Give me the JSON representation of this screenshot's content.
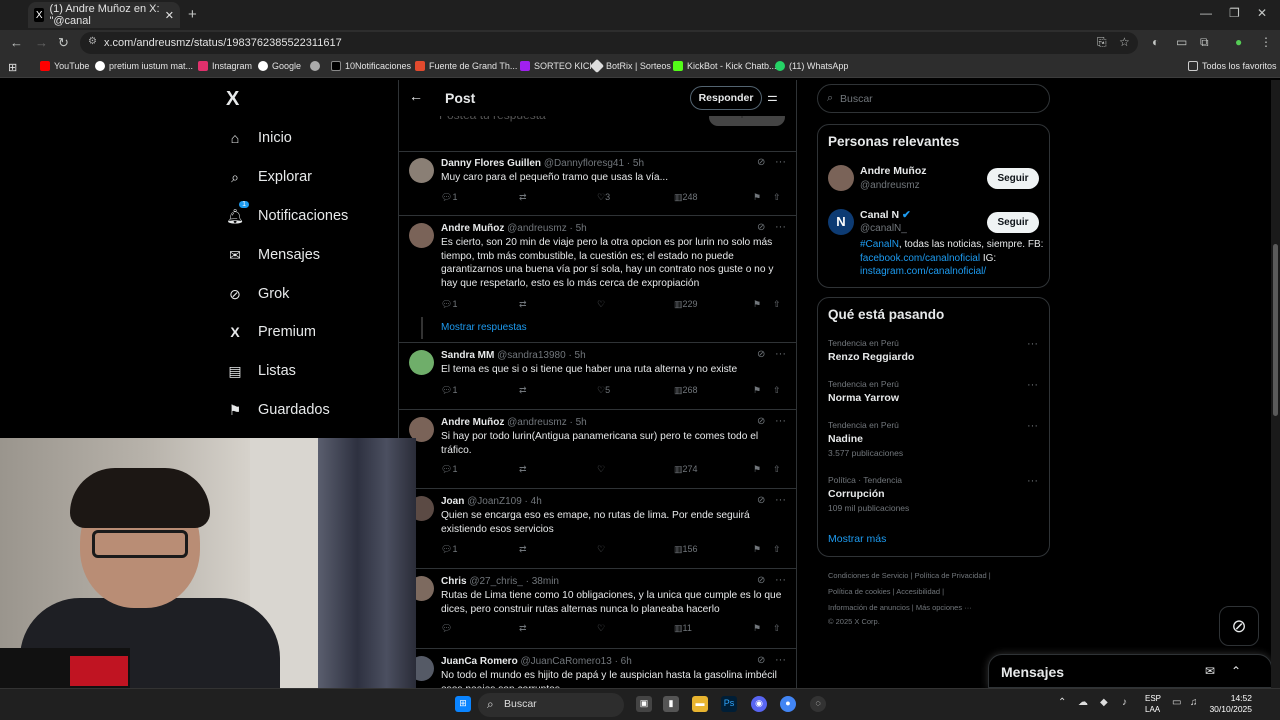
{
  "browser": {
    "tab_title": "(1) Andre Muñoz en X: \"@canal",
    "url": "x.com/andreusmz/status/1983762385522311617",
    "bookmarks": [
      {
        "label": "YouTube",
        "color": "#ff0000"
      },
      {
        "label": "pretium iustum mat...",
        "color": "#ffffff"
      },
      {
        "label": "Instagram",
        "color": "#e1306c"
      },
      {
        "label": "Google",
        "color": "#ffffff"
      },
      {
        "label": "",
        "color": "#aaaaaa"
      },
      {
        "label": "10Notificaciones",
        "color": "#000000"
      },
      {
        "label": "Fuente de Grand Th...",
        "color": "#e24a2e"
      },
      {
        "label": "SORTEO KICK",
        "color": "#a020f0"
      },
      {
        "label": "BotRix | Sorteos",
        "color": "#dddddd"
      },
      {
        "label": "KickBot - Kick Chatb...",
        "color": "#53fc18"
      },
      {
        "label": "(11) WhatsApp",
        "color": "#25d366"
      }
    ],
    "all_bookmarks": "Todos los favoritos"
  },
  "sidebar": {
    "logo": "X",
    "items": [
      {
        "label": "Inicio",
        "icon": "home-icon",
        "glyph": "⌂"
      },
      {
        "label": "Explorar",
        "icon": "search-icon",
        "glyph": "⌕"
      },
      {
        "label": "Notificaciones",
        "icon": "bell-icon",
        "glyph": "♫",
        "badge": "1"
      },
      {
        "label": "Mensajes",
        "icon": "mail-icon",
        "glyph": "✉"
      },
      {
        "label": "Grok",
        "icon": "grok-icon",
        "glyph": "⊘"
      },
      {
        "label": "Premium",
        "icon": "x-icon",
        "glyph": "X"
      },
      {
        "label": "Listas",
        "icon": "list-icon",
        "glyph": "▤"
      },
      {
        "label": "Guardados",
        "icon": "bookmark-icon",
        "glyph": "⚑"
      }
    ]
  },
  "post": {
    "title": "Post",
    "reply_button": "Responder",
    "ghost_text": "Postea tu respuesta",
    "ghost_button": "Responder",
    "show_replies": "Mostrar respuestas",
    "tweets": [
      {
        "name": "Danny Flores Guillen",
        "handle": "@Dannyfloresg41",
        "time": "· 5h",
        "text": "Muy caro para el pequeño tramo que usas la vía...",
        "replies": "1",
        "likes": "3",
        "views": "248",
        "avatar": "#8a7f75"
      },
      {
        "name": "Andre Muñoz",
        "handle": "@andreusmz",
        "time": "· 5h",
        "text": "Es cierto, son 20 min de viaje pero la otra opcion es por lurin no solo más tiempo, tmb más combustible, la cuestión es; el estado no puede garantizarnos una buena vía por sí sola, hay un contrato nos guste o no y hay que respetarlo, esto es lo más cerca de expropiación",
        "replies": "1",
        "likes": "",
        "views": "229",
        "avatar": "#7a6358"
      },
      {
        "name": "Sandra MM",
        "handle": "@sandra13980",
        "time": "· 5h",
        "text": "El tema es que si o si tiene que haber una ruta alterna y no existe",
        "replies": "1",
        "likes": "5",
        "views": "268",
        "avatar": "#6fae6a"
      },
      {
        "name": "Andre Muñoz",
        "handle": "@andreusmz",
        "time": "· 5h",
        "text": "Si hay por todo lurin(Antigua panamericana sur) pero te comes todo el tráfico.",
        "replies": "1",
        "likes": "",
        "views": "274",
        "avatar": "#7a6358"
      },
      {
        "name": "Joan",
        "handle": "@JoanZ109",
        "time": "· 4h",
        "text": "Quien se encarga eso es emape, no rutas de lima. Por ende seguirá existiendo esos servicios",
        "replies": "1",
        "likes": "",
        "views": "156",
        "avatar": "#5b4a44"
      },
      {
        "name": "Chris",
        "handle": "@27_chris_",
        "time": "· 38min",
        "text": "Rutas de Lima tiene como 10 obligaciones, y la unica que cumple es lo que dices, pero construir rutas alternas nunca lo planeaba hacerlo",
        "replies": "",
        "likes": "",
        "views": "11",
        "avatar": "#7d6a5f"
      },
      {
        "name": "JuanCa Romero",
        "handle": "@JuanCaRomero13",
        "time": "· 6h",
        "text": "No todo el mundo es hijito de papá y le auspician hasta la gasolina imbécil esos peajes son corruptos",
        "replies": "",
        "likes": "",
        "views": "",
        "avatar": "#555a66"
      }
    ]
  },
  "right": {
    "search_placeholder": "Buscar",
    "relevant_title": "Personas relevantes",
    "people": [
      {
        "name": "Andre Muñoz",
        "handle": "@andreusmz",
        "button": "Seguir"
      },
      {
        "name": "Canal N",
        "handle": "@canalN_",
        "button": "Seguir"
      }
    ],
    "bio_tag": "#CanalN",
    "bio_text": ", todas las noticias, siempre.",
    "bio_fb": "FB: ",
    "bio_fb_link": "facebook.com/canalnoficial",
    "bio_ig": " IG: ",
    "bio_ig_link": "instagram.com/canalnoficial/",
    "trending_title": "Qué está pasando",
    "trends": [
      {
        "category": "Tendencia en Perú",
        "name": "Renzo Reggiardo",
        "count": ""
      },
      {
        "category": "Tendencia en Perú",
        "name": "Norma Yarrow",
        "count": ""
      },
      {
        "category": "Tendencia en Perú",
        "name": "Nadine",
        "count": "3.577 publicaciones"
      },
      {
        "category": "Política · Tendencia",
        "name": "Corrupción",
        "count": "109 mil publicaciones"
      }
    ],
    "show_more": "Mostrar más",
    "footer": [
      "Condiciones de Servicio  |   Política de Privacidad  |",
      "Política de cookies  |   Accesibilidad  |",
      "Información de anuncios  |   Más opciones ···",
      "© 2025 X Corp."
    ]
  },
  "messages": {
    "title": "Mensajes"
  },
  "taskbar": {
    "search": "Buscar",
    "lang1": "ESP",
    "lang2": "LAA",
    "time": "14:52",
    "date": "30/10/2025"
  }
}
